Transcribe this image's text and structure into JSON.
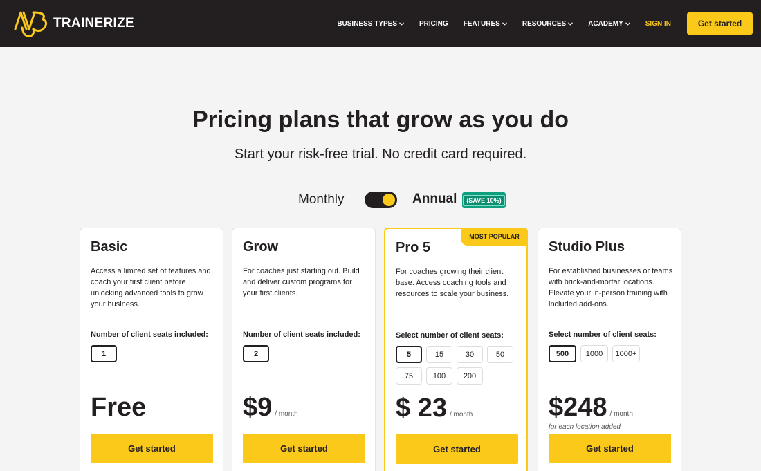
{
  "brand": {
    "name": "TRAINERIZE"
  },
  "nav": {
    "items": [
      {
        "label": "BUSINESS TYPES",
        "dropdown": true
      },
      {
        "label": "PRICING",
        "dropdown": false
      },
      {
        "label": "FEATURES",
        "dropdown": true
      },
      {
        "label": "RESOURCES",
        "dropdown": true
      },
      {
        "label": "ACADEMY",
        "dropdown": true
      }
    ],
    "sign_in": "SIGN IN",
    "cta": "Get started"
  },
  "hero": {
    "title": "Pricing plans that grow as you do",
    "subtitle": "Start your risk-free trial. No credit card required."
  },
  "billing": {
    "monthly_label": "Monthly",
    "annual_label": "Annual",
    "save_badge": "(SAVE 10%)",
    "selected": "Annual"
  },
  "plans": [
    {
      "name": "Basic",
      "description": "Access a limited set of features and coach your first client before unlocking advanced tools to grow your business.",
      "seat_label": "Number of client seats included:",
      "seats": [
        "1"
      ],
      "selected_seat": "1",
      "price": "Free",
      "per": "",
      "note": "",
      "cta": "Get started"
    },
    {
      "name": "Grow",
      "description": "For coaches just starting out. Build and deliver custom programs for your first clients.",
      "seat_label": "Number of client seats included:",
      "seats": [
        "2"
      ],
      "selected_seat": "2",
      "price": "$9",
      "per": "/ month",
      "note": "",
      "cta": "Get started"
    },
    {
      "name": "Pro 5",
      "tag": "MOST POPULAR",
      "description": "For coaches growing their client base. Access coaching tools and resources to scale your business.",
      "seat_label": "Select number of client seats:",
      "seats": [
        "5",
        "15",
        "30",
        "50",
        "75",
        "100",
        "200"
      ],
      "selected_seat": "5",
      "price": "$ 23",
      "per": "/ month",
      "note": "",
      "cta": "Get started"
    },
    {
      "name": "Studio Plus",
      "description": "For established businesses or teams with brick-and-mortar locations. Elevate your in-person training with included add-ons.",
      "seat_label": "Select number of client seats:",
      "seats": [
        "500",
        "1000",
        "1000+"
      ],
      "selected_seat": "500",
      "price": "$248",
      "per": "/ month",
      "note": "for each location added",
      "cta": "Get started"
    }
  ],
  "colors": {
    "accent": "#fbc91a",
    "dark": "#231f20",
    "save_badge": "#0f9e7e",
    "background": "#f4f4f4"
  }
}
